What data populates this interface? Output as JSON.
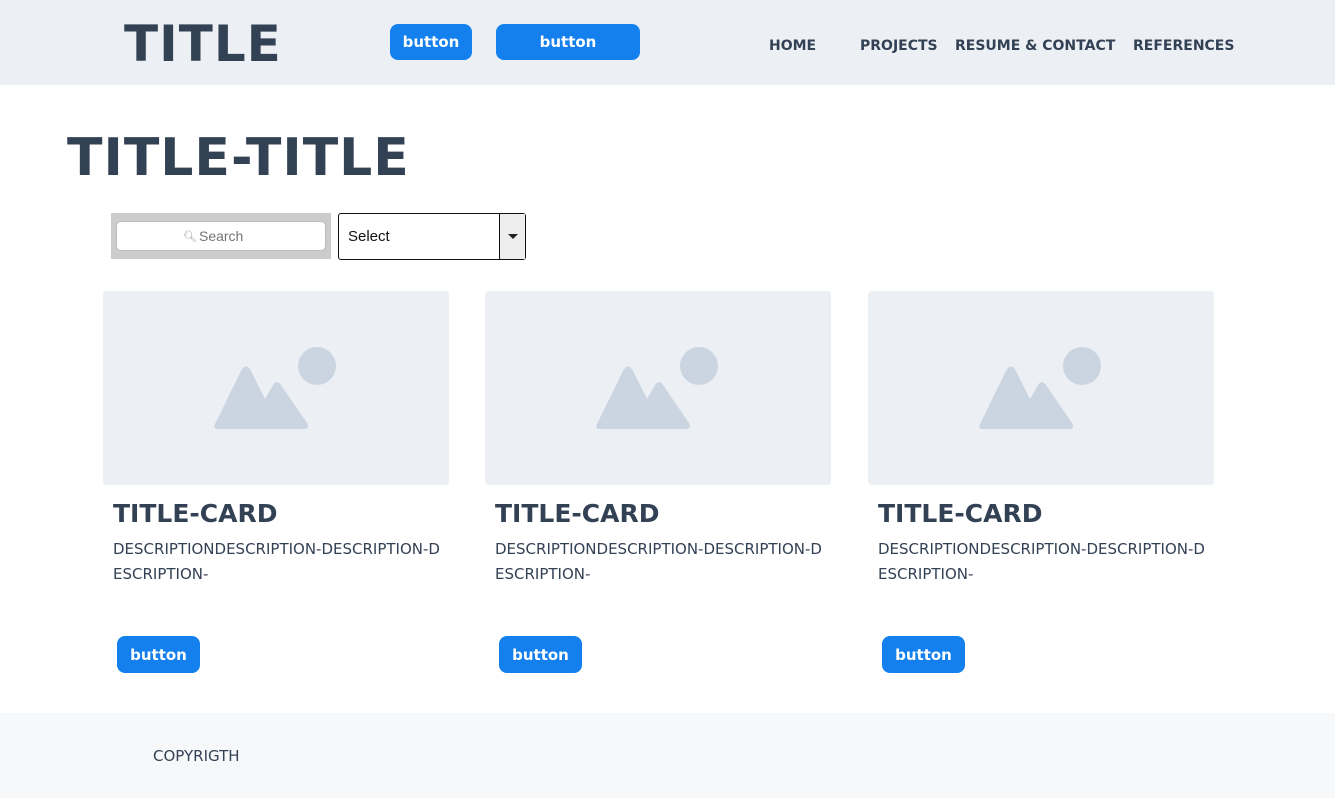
{
  "header": {
    "brand": "TITLE",
    "button1_label": "button",
    "button2_label": "button",
    "nav": [
      "HOME",
      "PROJECTS",
      "RESUME & CONTACT",
      "REFERENCES"
    ]
  },
  "main": {
    "title": "TITLE-TITLE",
    "search": {
      "placeholder": "Search",
      "icon": "search-icon"
    },
    "select": {
      "value": "Select"
    },
    "cards": [
      {
        "title": "TITLE-CARD",
        "description": "DESCRIPTIONDESCRIPTION-DESCRIPTION-DESCRIPTION-",
        "button_label": "button",
        "image_icon": "image-placeholder-icon"
      },
      {
        "title": "TITLE-CARD",
        "description": "DESCRIPTIONDESCRIPTION-DESCRIPTION-DESCRIPTION-",
        "button_label": "button",
        "image_icon": "image-placeholder-icon"
      },
      {
        "title": "TITLE-CARD",
        "description": "DESCRIPTIONDESCRIPTION-DESCRIPTION-DESCRIPTION-",
        "button_label": "button",
        "image_icon": "image-placeholder-icon"
      }
    ]
  },
  "footer": {
    "copyright": "COPYRIGTH"
  },
  "colors": {
    "accent": "#1380ee",
    "text": "#334155",
    "header_bg": "#eceff4",
    "footer_bg": "#f7f8fa",
    "placeholder_bg": "#eceff4",
    "placeholder_icon": "#cbd5e1"
  }
}
